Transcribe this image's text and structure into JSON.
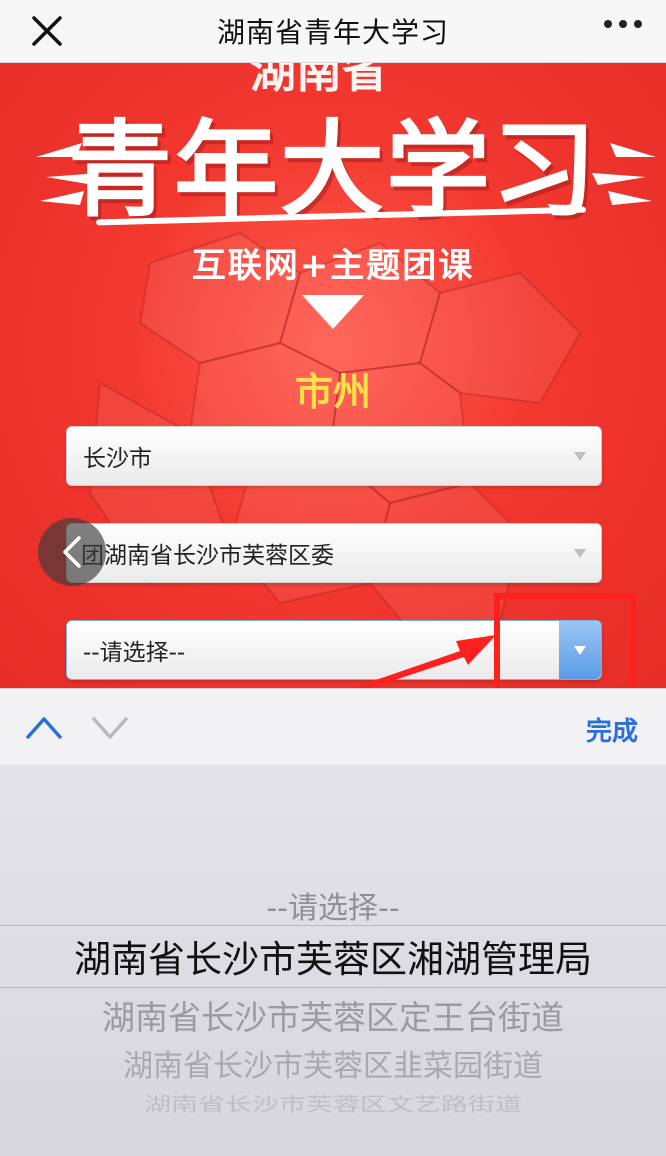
{
  "nav": {
    "title": "湖南省青年大学习",
    "close_icon": "close-icon",
    "more_icon": "more-dots-icon"
  },
  "hero": {
    "top_clip_text": "湖南省",
    "title": "青年大学习",
    "subtitle": "互联网+主题团课",
    "section_label": "市州",
    "colors": {
      "background": "#e52c26",
      "label": "#ffe14a"
    }
  },
  "form": {
    "select_city": {
      "value": "长沙市"
    },
    "select_district": {
      "value": "团湖南省长沙市芙蓉区委"
    },
    "select_org": {
      "value": "--请选择--"
    }
  },
  "toolbar": {
    "done_label": "完成",
    "up_icon": "chevron-up-icon",
    "down_icon": "chevron-down-icon"
  },
  "picker": {
    "items": [
      "--请选择--",
      "湖南省长沙市芙蓉区湘湖管理局",
      "湖南省长沙市芙蓉区定王台街道",
      "湖南省长沙市芙蓉区韭菜园街道",
      "湖南省长沙市芙蓉区文艺路街道"
    ],
    "selected_index": 1
  },
  "annotation": {
    "highlight_color": "#ff2020"
  }
}
